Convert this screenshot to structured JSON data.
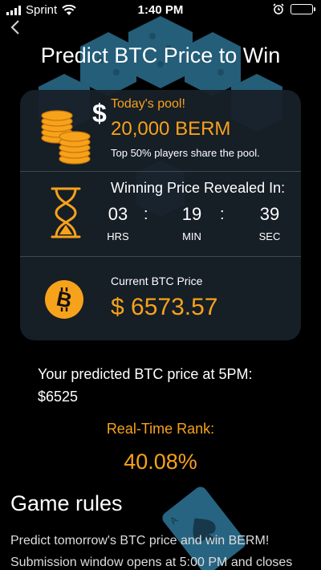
{
  "status_bar": {
    "carrier": "Sprint",
    "time": "1:40 PM"
  },
  "header": {
    "back_icon": "chevron-left-icon",
    "title": "Predict BTC Price to Win"
  },
  "pool": {
    "label": "Today's pool!",
    "amount": "20,000 BERM",
    "description": "Top 50% players share the pool."
  },
  "countdown": {
    "label": "Winning Price Revealed In:",
    "hours": "03",
    "minutes": "19",
    "seconds": "39",
    "hours_unit": "HRS",
    "minutes_unit": "MIN",
    "seconds_unit": "SEC",
    "separator": ":"
  },
  "btc": {
    "label": "Current BTC Price",
    "price": "$ 6573.57"
  },
  "prediction": {
    "label": "Your predicted BTC price at 5PM:",
    "value": "$6525"
  },
  "rank": {
    "label": "Real-Time Rank:",
    "value": "40.08%"
  },
  "rules": {
    "title": "Game rules",
    "text": "Predict tomorrow's BTC price and win BERM! Submission window opens at 5:00 PM and closes"
  },
  "colors": {
    "accent": "#f7a21b",
    "background": "#000000",
    "card": "#172028",
    "dice": "#2b6f8f"
  }
}
